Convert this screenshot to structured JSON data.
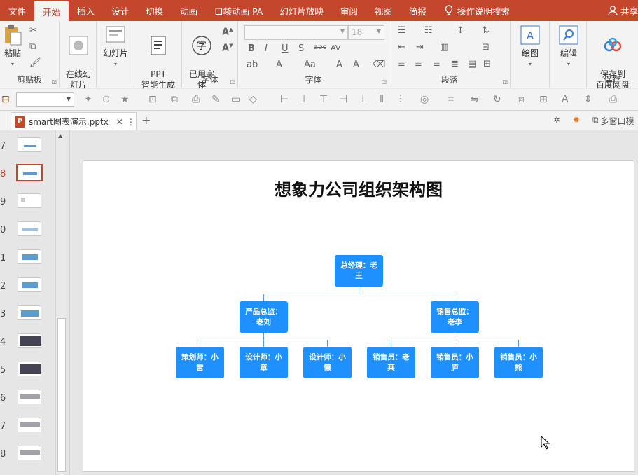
{
  "menu": {
    "tabs": [
      "文件",
      "开始",
      "插入",
      "设计",
      "切换",
      "动画",
      "口袋动画 PA",
      "幻灯片放映",
      "审阅",
      "视图",
      "简报"
    ],
    "active_tab": "开始",
    "search_hint": "操作说明搜索",
    "share": "共享"
  },
  "ribbon": {
    "paste": "粘贴",
    "clipboard_group": "剪贴板",
    "online_slides": "在线幻\n灯片",
    "slides": "幻灯片",
    "ppt_gen": "PPT\n智能生成",
    "font_use": "已用字\n体",
    "font_group_1": "字体",
    "font_size": "18",
    "font_group_2": "字体",
    "paragraph_group": "段落",
    "draw": "绘图",
    "edit": "编辑",
    "save_cloud": "保存到\n百度网盘",
    "save_group": "保存"
  },
  "doc_tab": {
    "filename": "smart图表演示.pptx",
    "multi_window": "多窗口模"
  },
  "slides_panel": {
    "numbers": [
      "7",
      "8",
      "9",
      "0",
      "1",
      "2",
      "3",
      "4",
      "5",
      "6",
      "7",
      "8"
    ],
    "active_index": 1
  },
  "slide": {
    "title": "想象力公司组织架构图",
    "org": {
      "root": "总经理：老王",
      "level2": [
        "产品总监：老刘",
        "销售总监：老李"
      ],
      "level3": [
        "策划师：小雷",
        "设计师：小章",
        "设计师：小懒",
        "销售员：老莱",
        "销售员：小庐",
        "销售员：小熊"
      ]
    }
  },
  "colors": {
    "accent": "#c4472d",
    "node": "#1e90ff",
    "connector": "#5aa0e0"
  }
}
